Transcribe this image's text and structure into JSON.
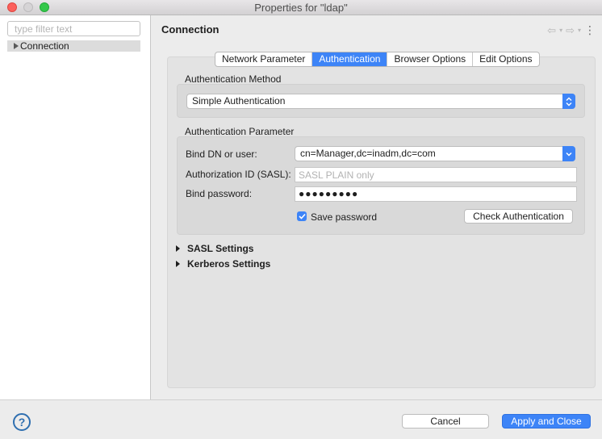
{
  "window": {
    "title": "Properties for \"ldap\""
  },
  "sidebar": {
    "filter_placeholder": "type filter text",
    "items": [
      {
        "label": "Connection"
      }
    ]
  },
  "page": {
    "title": "Connection"
  },
  "tabs": [
    {
      "label": "Network Parameter",
      "active": false
    },
    {
      "label": "Authentication",
      "active": true
    },
    {
      "label": "Browser Options",
      "active": false
    },
    {
      "label": "Edit Options",
      "active": false
    }
  ],
  "auth_method": {
    "section_label": "Authentication Method",
    "selected": "Simple Authentication"
  },
  "auth_param": {
    "section_label": "Authentication Parameter",
    "bind_dn_label": "Bind DN or user:",
    "bind_dn_value": "cn=Manager,dc=inadm,dc=com",
    "authz_label": "Authorization ID (SASL):",
    "authz_placeholder": "SASL PLAIN only",
    "password_label": "Bind password:",
    "password_dots": "●●●●●●●●●",
    "save_password_label": "Save password",
    "save_password_checked": true,
    "check_auth_button": "Check Authentication"
  },
  "expanders": [
    {
      "label": "SASL Settings"
    },
    {
      "label": "Kerberos Settings"
    }
  ],
  "footer": {
    "help": "?",
    "cancel": "Cancel",
    "apply_close": "Apply and Close"
  },
  "colors": {
    "accent": "#3d84f7"
  },
  "icons": {
    "back": "back-arrow-icon",
    "forward": "forward-arrow-icon",
    "menu": "view-menu-icon",
    "help": "help-icon"
  }
}
